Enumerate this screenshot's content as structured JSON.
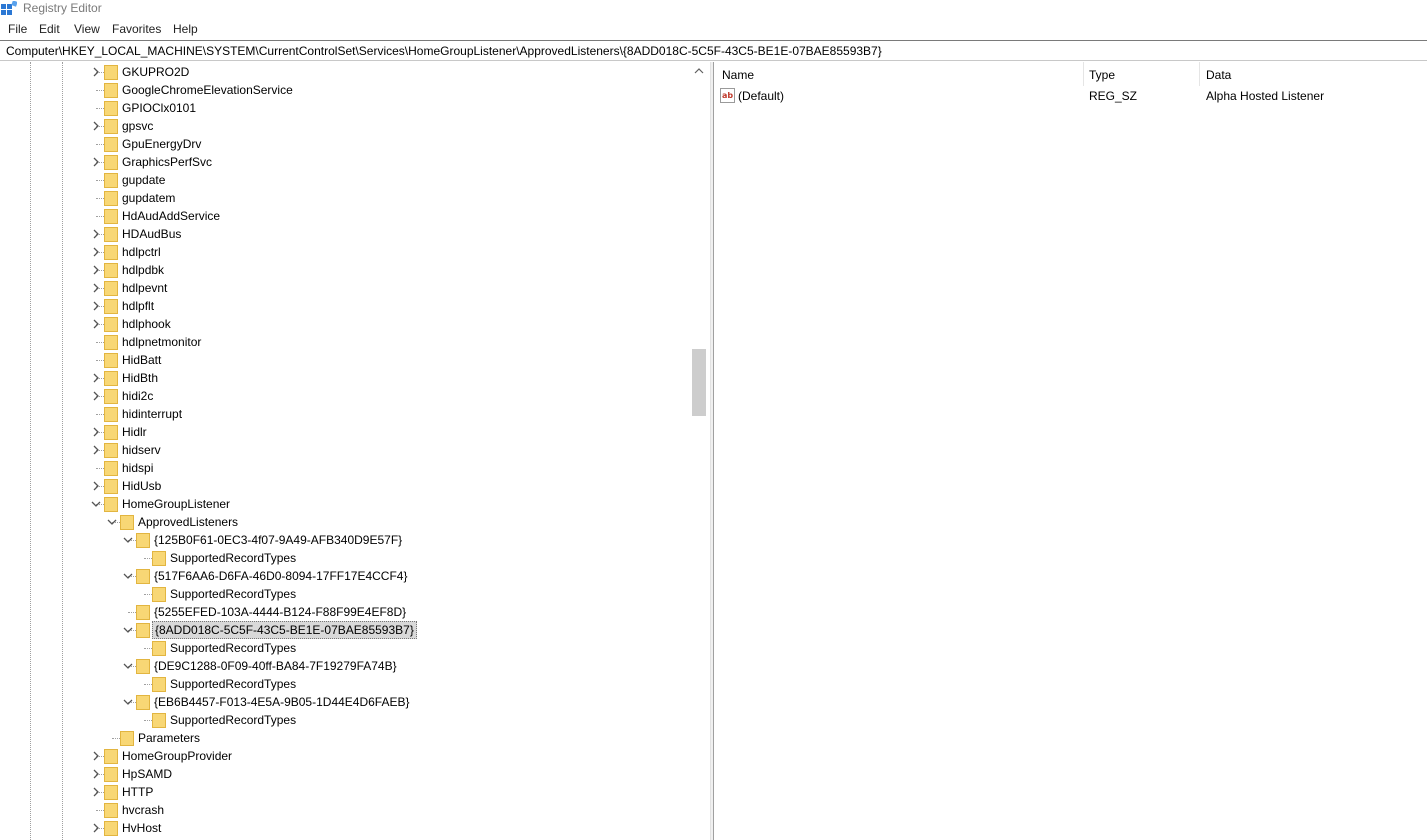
{
  "window": {
    "title": "Registry Editor"
  },
  "menu": [
    "File",
    "Edit",
    "View",
    "Favorites",
    "Help"
  ],
  "address": "Computer\\HKEY_LOCAL_MACHINE\\SYSTEM\\CurrentControlSet\\Services\\HomeGroupListener\\ApprovedListeners\\{8ADD018C-5C5F-43C5-BE1E-07BAE85593B7}",
  "tree": [
    {
      "label": "GKUPRO2D",
      "level": 0,
      "expander": "collapsed"
    },
    {
      "label": "GoogleChromeElevationService",
      "level": 0,
      "expander": "none"
    },
    {
      "label": "GPIOClx0101",
      "level": 0,
      "expander": "none"
    },
    {
      "label": "gpsvc",
      "level": 0,
      "expander": "collapsed"
    },
    {
      "label": "GpuEnergyDrv",
      "level": 0,
      "expander": "none"
    },
    {
      "label": "GraphicsPerfSvc",
      "level": 0,
      "expander": "collapsed"
    },
    {
      "label": "gupdate",
      "level": 0,
      "expander": "none"
    },
    {
      "label": "gupdatem",
      "level": 0,
      "expander": "none"
    },
    {
      "label": "HdAudAddService",
      "level": 0,
      "expander": "none"
    },
    {
      "label": "HDAudBus",
      "level": 0,
      "expander": "collapsed"
    },
    {
      "label": "hdlpctrl",
      "level": 0,
      "expander": "collapsed"
    },
    {
      "label": "hdlpdbk",
      "level": 0,
      "expander": "collapsed"
    },
    {
      "label": "hdlpevnt",
      "level": 0,
      "expander": "collapsed"
    },
    {
      "label": "hdlpflt",
      "level": 0,
      "expander": "collapsed"
    },
    {
      "label": "hdlphook",
      "level": 0,
      "expander": "collapsed"
    },
    {
      "label": "hdlpnetmonitor",
      "level": 0,
      "expander": "none"
    },
    {
      "label": "HidBatt",
      "level": 0,
      "expander": "none"
    },
    {
      "label": "HidBth",
      "level": 0,
      "expander": "collapsed"
    },
    {
      "label": "hidi2c",
      "level": 0,
      "expander": "collapsed"
    },
    {
      "label": "hidinterrupt",
      "level": 0,
      "expander": "none"
    },
    {
      "label": "Hidlr",
      "level": 0,
      "expander": "collapsed"
    },
    {
      "label": "hidserv",
      "level": 0,
      "expander": "collapsed"
    },
    {
      "label": "hidspi",
      "level": 0,
      "expander": "none"
    },
    {
      "label": "HidUsb",
      "level": 0,
      "expander": "collapsed"
    },
    {
      "label": "HomeGroupListener",
      "level": 0,
      "expander": "expanded"
    },
    {
      "label": "ApprovedListeners",
      "level": 1,
      "expander": "expanded"
    },
    {
      "label": "{125B0F61-0EC3-4f07-9A49-AFB340D9E57F}",
      "level": 2,
      "expander": "expanded"
    },
    {
      "label": "SupportedRecordTypes",
      "level": 3,
      "expander": "none"
    },
    {
      "label": "{517F6AA6-D6FA-46D0-8094-17FF17E4CCF4}",
      "level": 2,
      "expander": "expanded"
    },
    {
      "label": "SupportedRecordTypes",
      "level": 3,
      "expander": "none"
    },
    {
      "label": "{5255EFED-103A-4444-B124-F88F99E4EF8D}",
      "level": 2,
      "expander": "none"
    },
    {
      "label": "{8ADD018C-5C5F-43C5-BE1E-07BAE85593B7}",
      "level": 2,
      "expander": "expanded",
      "selected": true
    },
    {
      "label": "SupportedRecordTypes",
      "level": 3,
      "expander": "none"
    },
    {
      "label": "{DE9C1288-0F09-40ff-BA84-7F19279FA74B}",
      "level": 2,
      "expander": "expanded"
    },
    {
      "label": "SupportedRecordTypes",
      "level": 3,
      "expander": "none"
    },
    {
      "label": "{EB6B4457-F013-4E5A-9B05-1D44E4D6FAEB}",
      "level": 2,
      "expander": "expanded"
    },
    {
      "label": "SupportedRecordTypes",
      "level": 3,
      "expander": "none"
    },
    {
      "label": "Parameters",
      "level": 1,
      "expander": "none"
    },
    {
      "label": "HomeGroupProvider",
      "level": 0,
      "expander": "collapsed"
    },
    {
      "label": "HpSAMD",
      "level": 0,
      "expander": "collapsed"
    },
    {
      "label": "HTTP",
      "level": 0,
      "expander": "collapsed"
    },
    {
      "label": "hvcrash",
      "level": 0,
      "expander": "none"
    },
    {
      "label": "HvHost",
      "level": 0,
      "expander": "collapsed"
    }
  ],
  "list": {
    "columns": [
      "Name",
      "Type",
      "Data"
    ],
    "rows": [
      {
        "name": "(Default)",
        "type": "REG_SZ",
        "data": "Alpha Hosted Listener",
        "icon": "string-value-icon"
      }
    ]
  },
  "colors": {
    "folder": "#f8d775",
    "folder_edge": "#e2b540",
    "selection": "#d9d9d9"
  }
}
